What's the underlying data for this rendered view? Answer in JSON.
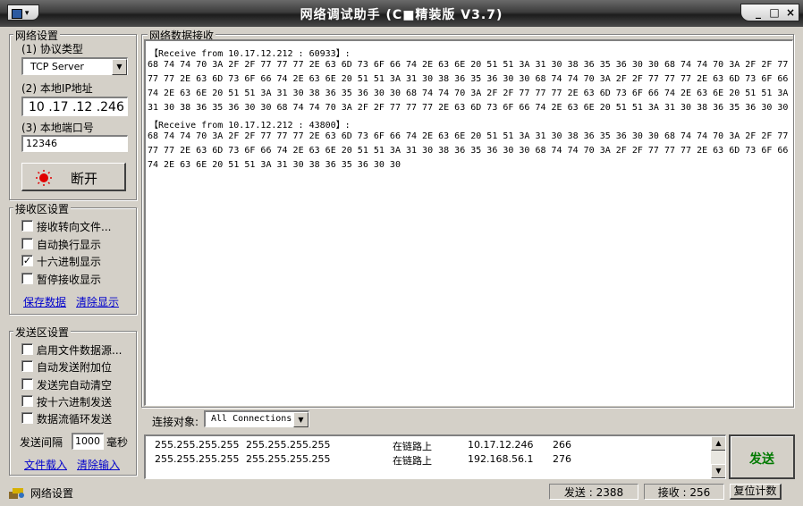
{
  "window": {
    "title": "网络调试助手 (C■精装版 V3.7)",
    "sysmenu_label": "▾",
    "min": "_",
    "max": "□",
    "close": "×"
  },
  "network_settings": {
    "legend": "网络设置",
    "protocol_label": "(1) 协议类型",
    "protocol_value": "TCP Server",
    "ip_label": "(2) 本地IP地址",
    "ip_value": "10 .17 .12 .246",
    "port_label": "(3) 本地端口号",
    "port_value": "12346",
    "connect_button": "断开"
  },
  "receive_settings": {
    "legend": "接收区设置",
    "options": [
      {
        "label": "接收转向文件...",
        "checked": false
      },
      {
        "label": "自动换行显示",
        "checked": false
      },
      {
        "label": "十六进制显示",
        "checked": true
      },
      {
        "label": "暂停接收显示",
        "checked": false
      }
    ],
    "save_link": "保存数据",
    "clear_link": "清除显示"
  },
  "send_settings": {
    "legend": "发送区设置",
    "options": [
      {
        "label": "启用文件数据源...",
        "checked": false
      },
      {
        "label": "自动发送附加位",
        "checked": false
      },
      {
        "label": "发送完自动清空",
        "checked": false
      },
      {
        "label": "按十六进制发送",
        "checked": false
      },
      {
        "label": "数据流循环发送",
        "checked": false
      }
    ],
    "interval_label": "发送间隔",
    "interval_value": "1000",
    "interval_unit": "毫秒",
    "load_link": "文件载入",
    "clear_link": "清除输入"
  },
  "receive_area": {
    "legend": "网络数据接收",
    "lines": [
      "【Receive from 10.17.12.212 : 60933】:",
      "68 74 74 70 3A 2F 2F 77 77 77 2E 63 6D 73 6F 66 74 2E 63 6E 20 51 51 3A 31 30 38 36 35 36 30 30 68 74 74 70 3A 2F 2F 77",
      "77 77 2E 63 6D 73 6F 66 74 2E 63 6E 20 51 51 3A 31 30 38 36 35 36 30 30 68 74 74 70 3A 2F 2F 77 77 77 2E 63 6D 73 6F 66",
      "74 2E 63 6E 20 51 51 3A 31 30 38 36 35 36 30 30 68 74 74 70 3A 2F 2F 77 77 77 2E 63 6D 73 6F 66 74 2E 63 6E 20 51 51 3A",
      "31 30 38 36 35 36 30 30 68 74 74 70 3A 2F 2F 77 77 77 2E 63 6D 73 6F 66 74 2E 63 6E 20 51 51 3A 31 30 38 36 35 36 30 30",
      "【Receive from 10.17.12.212 : 43800】:",
      "68 74 74 70 3A 2F 2F 77 77 77 2E 63 6D 73 6F 66 74 2E 63 6E 20 51 51 3A 31 30 38 36 35 36 30 30 68 74 74 70 3A 2F 2F 77",
      "77 77 2E 63 6D 73 6F 66 74 2E 63 6E 20 51 51 3A 31 30 38 36 35 36 30 30 68 74 74 70 3A 2F 2F 77 77 77 2E 63 6D 73 6F 66",
      "74 2E 63 6E 20 51 51 3A 31 30 38 36 35 36 30 30"
    ]
  },
  "connection": {
    "label": "连接对象:",
    "target": "All Connections",
    "rows": [
      [
        "255.255.255.255",
        "255.255.255.255",
        "在链路上",
        "10.17.12.246",
        "266"
      ],
      [
        "255.255.255.255",
        "255.255.255.255",
        "在链路上",
        "192.168.56.1",
        "276"
      ]
    ]
  },
  "send_button": "发送",
  "status": {
    "text": "网络设置",
    "sent_label": "发送 : 2388",
    "recv_label": "接收 : 256",
    "reset_button": "复位计数"
  },
  "colors": {
    "send_button_text": "#007a00",
    "link": "#0000cc"
  }
}
